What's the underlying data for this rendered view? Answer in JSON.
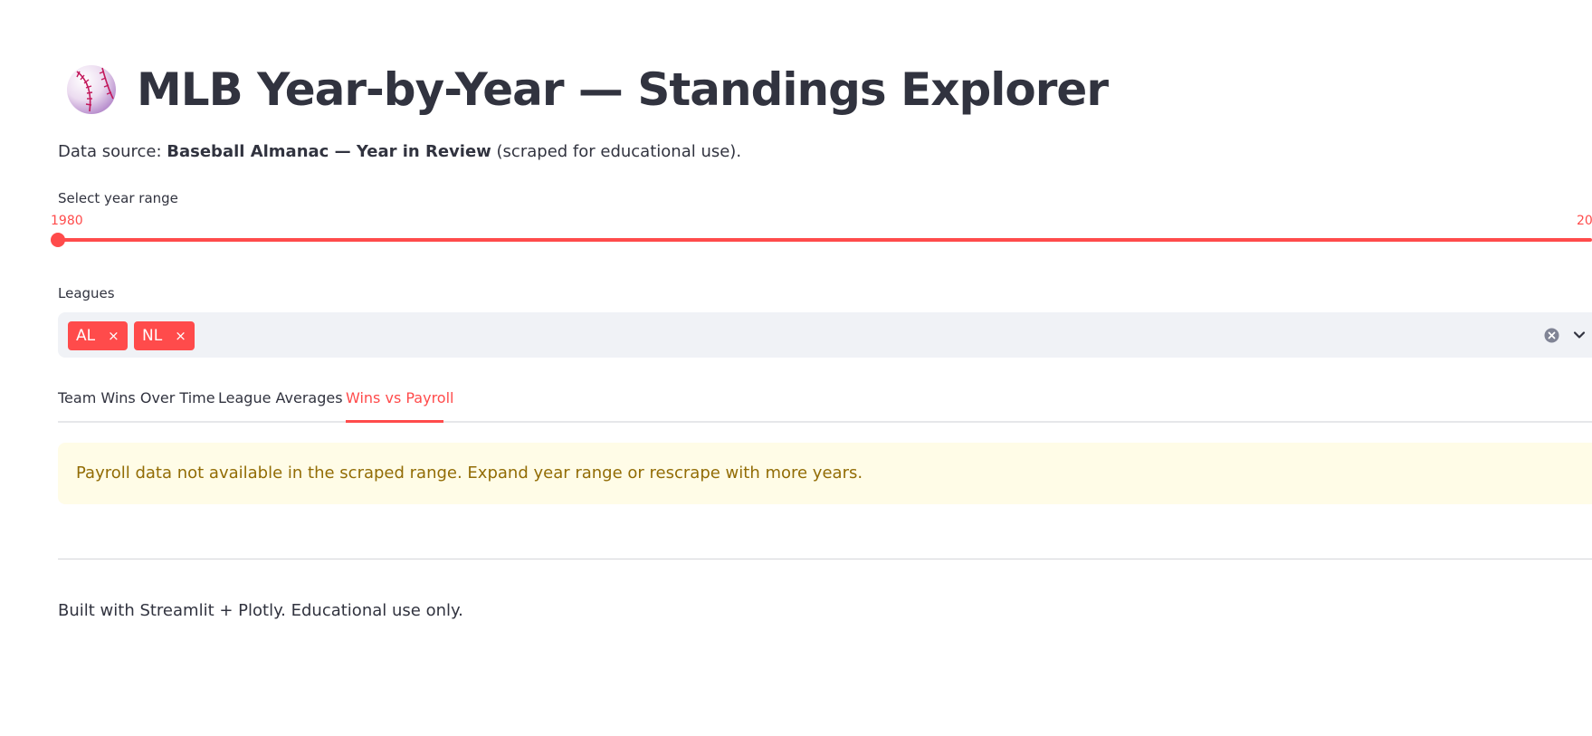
{
  "header": {
    "icon": "baseball-icon",
    "title": "MLB Year-by-Year — Standings Explorer"
  },
  "source": {
    "prefix": "Data source: ",
    "name": "Baseball Almanac — Year in Review",
    "suffix": " (scraped for educational use)."
  },
  "year_slider": {
    "label": "Select year range",
    "min_label": "1980",
    "max_label_visible": "20"
  },
  "leagues": {
    "label": "Leagues",
    "selected": [
      "AL",
      "NL"
    ],
    "remove_glyph": "×"
  },
  "tabs": [
    {
      "label": "Team Wins Over Time",
      "active": false
    },
    {
      "label": "League Averages",
      "active": false
    },
    {
      "label": "Wins vs Payroll",
      "active": true
    }
  ],
  "alert": {
    "text": "Payroll data not available in the scraped range. Expand year range or rescrape with more years."
  },
  "footer": {
    "text": "Built with Streamlit + Plotly. Educational use only."
  },
  "colors": {
    "accent": "#ff4b4b",
    "text": "#31333f",
    "warning_bg": "#fffce7",
    "warning_text": "#926c05",
    "input_bg": "#f0f2f6"
  }
}
